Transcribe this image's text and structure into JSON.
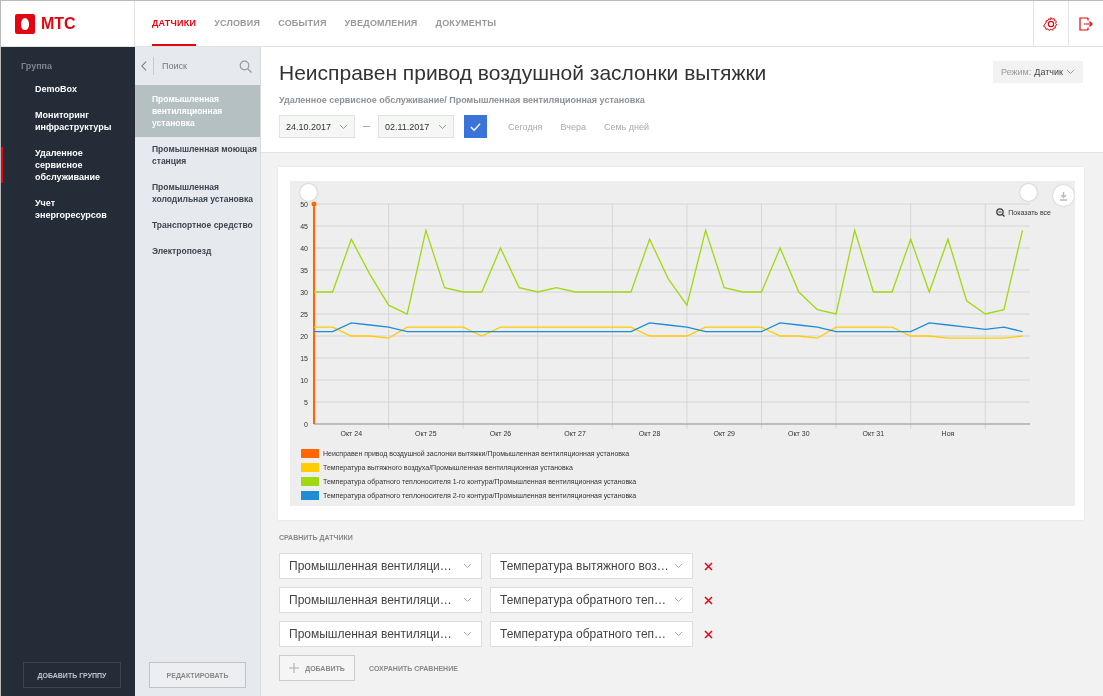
{
  "logo": {
    "text": "МТС"
  },
  "tabs": [
    {
      "label": "ДАТЧИКИ",
      "selected": true
    },
    {
      "label": "УСЛОВИЯ",
      "selected": false
    },
    {
      "label": "СОБЫТИЯ",
      "selected": false
    },
    {
      "label": "УВЕДОМЛЕНИЯ",
      "selected": false
    },
    {
      "label": "ДОКУМЕНТЫ",
      "selected": false
    }
  ],
  "sidebar": {
    "heading": "Группа",
    "items": [
      {
        "label": "DemoBox",
        "selected": false
      },
      {
        "label": "Мониторинг инфраструктуры",
        "selected": false
      },
      {
        "label": "Удаленное сервисное обслуживание",
        "selected": true
      },
      {
        "label": "Учет энергоресурсов",
        "selected": false
      }
    ],
    "button": "ДОБАВИТЬ ГРУППУ"
  },
  "objects": {
    "search": {
      "placeholder": "Поиск"
    },
    "items": [
      {
        "label": "Промышленная вентиляционная установка",
        "selected": true
      },
      {
        "label": "Промышленная моющая станция",
        "selected": false
      },
      {
        "label": "Промышленная холодильная установка",
        "selected": false
      },
      {
        "label": "Транспортное средство",
        "selected": false
      },
      {
        "label": "Электропоезд",
        "selected": false
      }
    ],
    "button": "РЕДАКТИРОВАТЬ"
  },
  "page": {
    "title": "Неисправен привод воздушной заслонки вытяжки",
    "breadcrumb": "Удаленное сервисное обслуживание/ Промышленная вентиляционная установка",
    "mode": {
      "label": "Режим:",
      "value": "Датчик"
    },
    "date_from": "24.10.2017",
    "date_to": "02.11.2017",
    "quick_ranges": [
      "Сегодня",
      "Вчера",
      "Семь дней"
    ]
  },
  "chart": {
    "reset_zoom": "Показать все",
    "chart_data": {
      "type": "line",
      "categories": [
        null,
        null,
        "Окт 24",
        null,
        null,
        null,
        "Окт 25",
        null,
        null,
        null,
        "Окт 26",
        null,
        null,
        null,
        "Окт 27",
        null,
        null,
        null,
        "Окт 28",
        null,
        null,
        null,
        "Окт 29",
        null,
        null,
        null,
        "Окт 30",
        null,
        null,
        null,
        "Окт 31",
        null,
        null,
        null,
        "Ноя",
        null,
        null,
        null,
        null
      ],
      "ylim": [
        0,
        50
      ],
      "grid": true,
      "legend": true,
      "yticks": [
        0,
        5,
        10,
        15,
        20,
        25,
        30,
        35,
        40,
        45,
        50
      ],
      "series": [
        {
          "name": "Неисправен привод воздушной заслонки вытяжки/Промышленная вентиляционная установка",
          "color": "#ff6600",
          "marker": true,
          "values": [
            50,
            null,
            null,
            null,
            null,
            null,
            null,
            null,
            null,
            null,
            null,
            null,
            null,
            null,
            null,
            null,
            null,
            null,
            null,
            null,
            null,
            null,
            null,
            null,
            null,
            null,
            null,
            null,
            null,
            null,
            null,
            null,
            null,
            null,
            null,
            null,
            null,
            null,
            null
          ]
        },
        {
          "name": "Температура вытяжного воздуха/Промышленная вентиляционная установка",
          "color": "#ffcc00",
          "values": [
            22,
            22,
            20,
            20,
            19.5,
            22,
            22,
            22,
            22,
            20,
            22,
            22,
            22,
            22,
            22,
            22,
            22,
            22,
            20,
            20,
            20,
            22,
            22,
            22,
            22,
            20,
            20,
            19.5,
            22,
            22,
            22,
            22,
            20,
            20,
            19.5,
            19.5,
            19.5,
            19.5,
            20
          ]
        },
        {
          "name": "Температура обратного теплоносителя 1-го контура/Промышленная вентиляционная установка",
          "color": "#a0d911",
          "values": [
            30,
            30,
            42,
            34,
            27,
            25,
            44,
            31,
            30,
            30,
            40,
            31,
            30,
            31,
            30,
            30,
            30,
            30,
            42,
            33,
            27,
            44,
            31,
            30,
            30,
            40,
            30,
            26,
            25,
            44,
            30,
            30,
            42,
            30,
            42,
            28,
            25,
            26,
            44
          ]
        },
        {
          "name": "Температура обратного теплоносителя 2-го контура/Промышленная вентиляционная установка",
          "color": "#1f8dd6",
          "values": [
            21,
            21,
            23,
            22.5,
            22,
            21,
            21,
            21,
            21,
            21,
            21,
            21,
            21,
            21,
            21,
            21,
            21,
            21,
            23,
            22.5,
            22,
            21,
            21,
            21,
            21,
            23,
            22.5,
            22,
            21,
            21,
            21,
            21,
            21,
            23,
            22.5,
            22,
            21.5,
            22,
            21
          ]
        }
      ]
    }
  },
  "compare": {
    "heading": "СРАВНИТЬ ДАТЧИКИ",
    "rows": [
      {
        "object": "Промышленная вентиляци…",
        "sensor": "Температура вытяжного воз…"
      },
      {
        "object": "Промышленная вентиляци…",
        "sensor": "Температура обратного теп…"
      },
      {
        "object": "Промышленная вентиляци…",
        "sensor": "Температура обратного теп…"
      }
    ],
    "add": "ДОБАВИТЬ",
    "save": "СОХРАНИТЬ СРАВНЕНИЕ"
  }
}
